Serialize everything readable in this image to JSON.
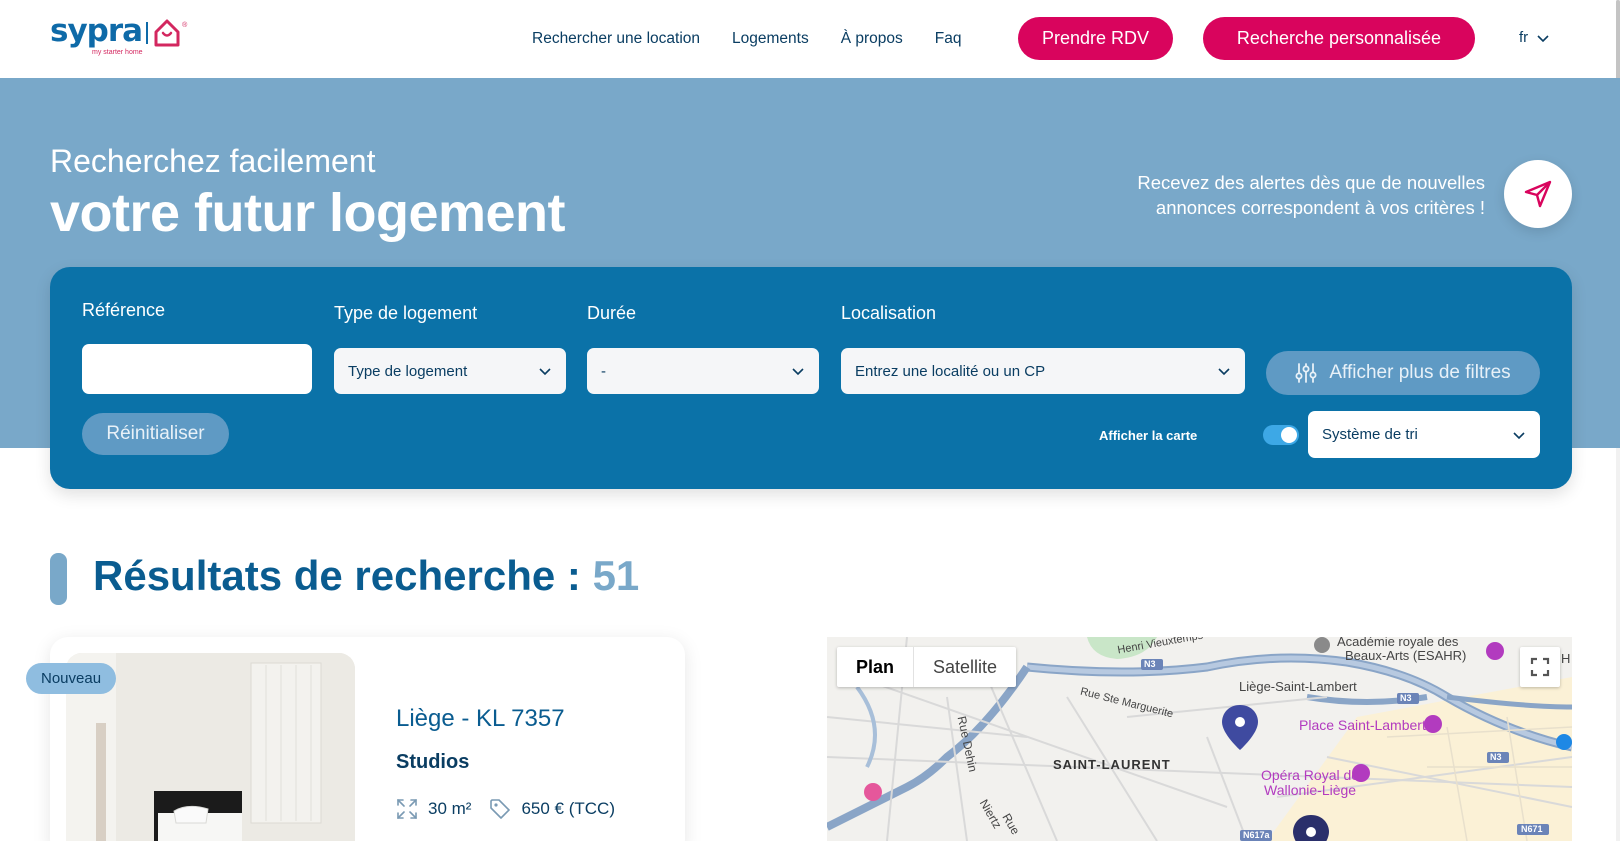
{
  "header": {
    "logo_text": "sypra",
    "logo_tagline": "my starter home",
    "nav": [
      "Rechercher une location",
      "Logements",
      "À propos",
      "Faq"
    ],
    "btn_rdv": "Prendre RDV",
    "btn_custom": "Recherche personnalisée",
    "lang": "fr"
  },
  "hero": {
    "subtitle": "Recherchez facilement",
    "title": "votre futur logement",
    "alert_line1": "Recevez des alertes dès que de nouvelles",
    "alert_line2": "annonces correspondent à vos critères !"
  },
  "search": {
    "ref_label": "Référence",
    "ref_value": "",
    "type_label": "Type de logement",
    "type_value": "Type de logement",
    "duration_label": "Durée",
    "duration_value": "-",
    "location_label": "Localisation",
    "location_value": "Entrez une localité ou un CP",
    "more_filters": "Afficher plus de filtres",
    "reset": "Réinitialiser",
    "show_map": "Afficher la carte",
    "show_map_on": true,
    "sort_value": "Système de tri"
  },
  "results": {
    "title": "Résultats de recherche",
    "separator": ":",
    "count": "51"
  },
  "listing": {
    "badge": "Nouveau",
    "city_ref": "Liège - KL 7357",
    "type": "Studios",
    "area": "30 m²",
    "price": "650 € (TCC)"
  },
  "map": {
    "tab_plan": "Plan",
    "tab_satellite": "Satellite",
    "labels": {
      "academie1": "Académie royale des",
      "academie2": "Beaux-Arts (ESAHR)",
      "vieuxtemps": "Henri Vieuxtemps",
      "n3a": "N3",
      "n3b": "N3",
      "n3c": "N3",
      "station": "Liège-Saint-Lambert",
      "marguerite": "Rue Ste Marguerite",
      "place": "Place Saint-Lambert",
      "dehin": "Rue Dehin",
      "quartier": "SAINT-LAURENT",
      "opera1": "Opéra Royal de",
      "opera2": "Wallonie-Liège",
      "niertz": "Niertz",
      "rue": "Rue",
      "n617": "N617a",
      "n671": "N671",
      "h": "H"
    }
  },
  "colors": {
    "primary": "#0b72a8",
    "hero_bg": "#79a8c9",
    "pink": "#d9045d",
    "dark_text": "#0a3d62"
  }
}
